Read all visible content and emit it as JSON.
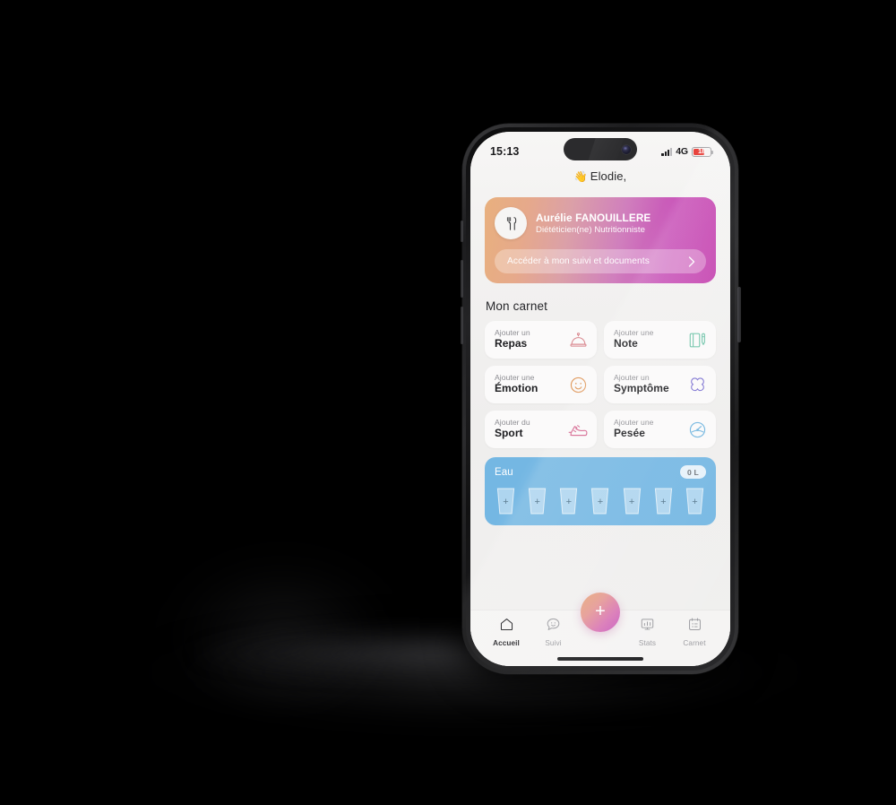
{
  "status_bar": {
    "time": "15:13",
    "network": "4G",
    "battery_level": "18",
    "signal_icon": "signal-bars-icon",
    "battery_icon": "battery-icon",
    "battery_color": "#e8403a"
  },
  "greeting": {
    "emoji": "👋",
    "text": "Elodie,"
  },
  "practitioner_card": {
    "avatar_icon": "fork-icon",
    "name": "Aurélie FANOUILLERE",
    "role": "Diététicien(ne) Nutritionniste",
    "cta_label": "Accéder à mon suivi et documents",
    "cta_icon": "chevron-right-icon",
    "gradient_start": "#e8b07e",
    "gradient_end": "#c43fae"
  },
  "notebook": {
    "title": "Mon carnet",
    "cards": [
      {
        "prefix": "Ajouter un",
        "name": "Repas",
        "icon": "cloche-icon",
        "color": "#d9888f"
      },
      {
        "prefix": "Ajouter une",
        "name": "Note",
        "icon": "notebook-pen-icon",
        "color": "#6ec3a8"
      },
      {
        "prefix": "Ajouter une",
        "name": "Émotion",
        "icon": "smiley-icon",
        "color": "#e09a5e"
      },
      {
        "prefix": "Ajouter un",
        "name": "Symptôme",
        "icon": "clover-icon",
        "color": "#7a6fd0"
      },
      {
        "prefix": "Ajouter du",
        "name": "Sport",
        "icon": "sneaker-icon",
        "color": "#d4628c"
      },
      {
        "prefix": "Ajouter une",
        "name": "Pesée",
        "icon": "scale-gauge-icon",
        "color": "#6fb4de"
      }
    ]
  },
  "water": {
    "title": "Eau",
    "amount": "0 L",
    "glass_count": 7,
    "glass_add_symbol": "+",
    "card_color": "#74b7e3"
  },
  "bottom_nav": {
    "items": [
      {
        "label": "Accueil",
        "icon": "home-icon",
        "active": true
      },
      {
        "label": "Suivi",
        "icon": "chat-smiley-icon",
        "active": false
      },
      {
        "label": "Stats",
        "icon": "bar-chart-icon",
        "active": false
      },
      {
        "label": "Carnet",
        "icon": "notebook-grid-icon",
        "active": false
      }
    ],
    "fab": {
      "icon": "plus-icon",
      "symbol": "+"
    }
  }
}
